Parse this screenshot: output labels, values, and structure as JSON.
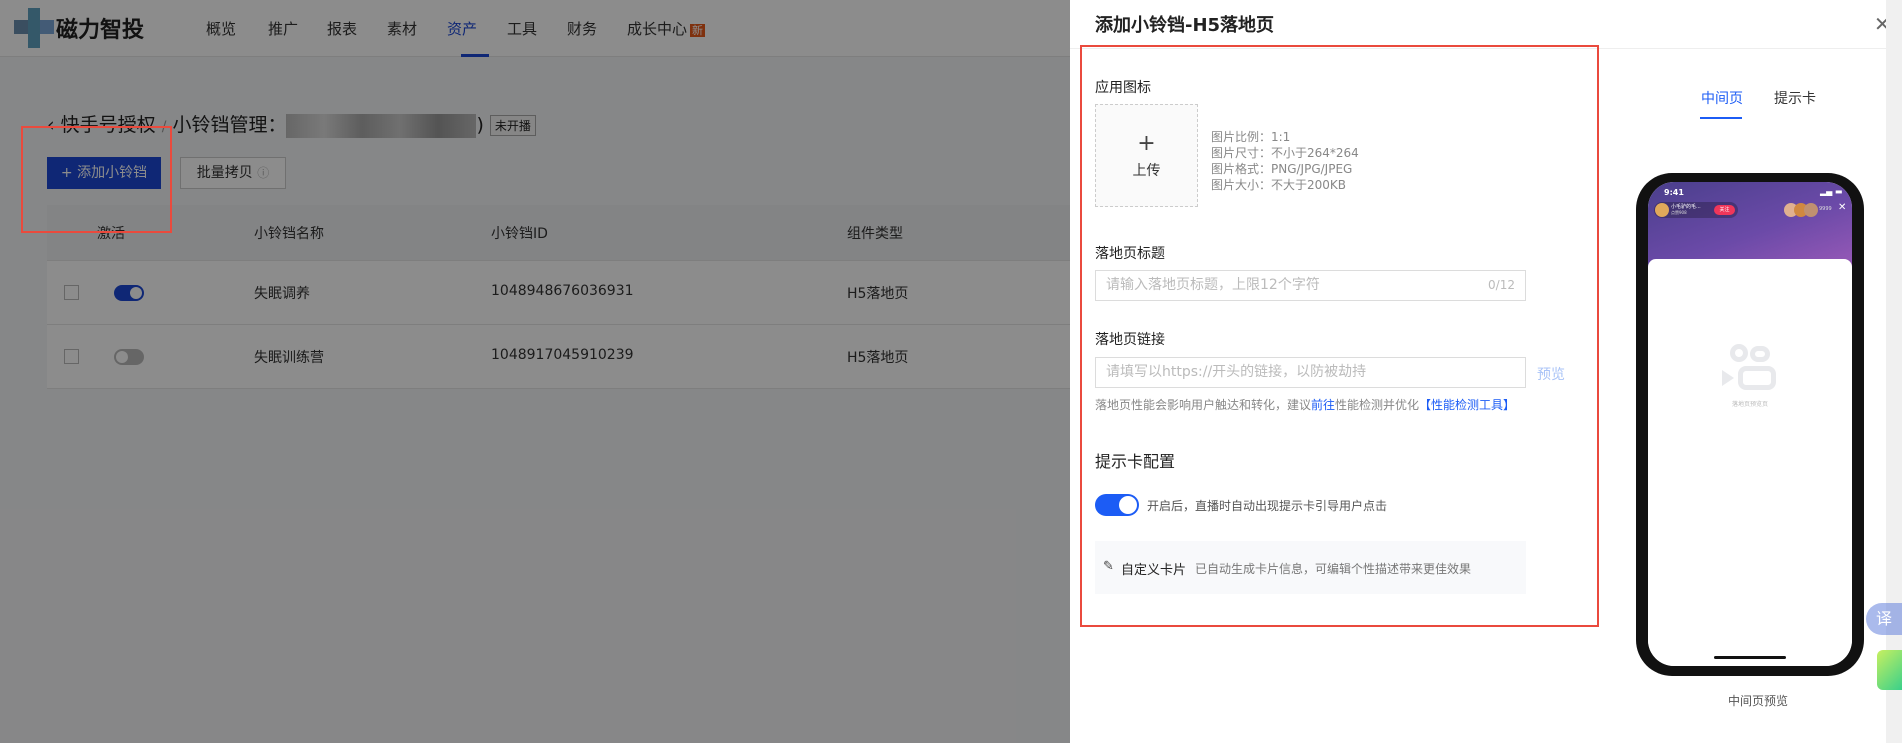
{
  "nav": {
    "brand": "磁力智投",
    "items": [
      "概览",
      "推广",
      "报表",
      "素材",
      "资产",
      "工具",
      "财务",
      "成长中心"
    ],
    "active": "资产",
    "new_badge": "新"
  },
  "breadcrumb": {
    "parent": "快手号授权",
    "sep": "/",
    "current": "小铃铛管理：",
    "suffix": ")",
    "status": "未开播"
  },
  "actions": {
    "add": "+ 添加小铃铛",
    "batch": "批量拷贝"
  },
  "table": {
    "headers": [
      "激活",
      "小铃铛名称",
      "小铃铛ID",
      "组件类型"
    ],
    "rows": [
      {
        "active": true,
        "name": "失眠调养",
        "id": "1048948676036931",
        "type": "H5落地页"
      },
      {
        "active": false,
        "name": "失眠训练营",
        "id": "1048917045910239",
        "type": "H5落地页"
      }
    ]
  },
  "drawer": {
    "title": "添加小铃铛-H5落地页",
    "icon_label": "应用图标",
    "upload_label": "上传",
    "icon_info": [
      "图片比例：1:1",
      "图片尺寸：不小于264*264",
      "图片格式：PNG/JPG/JPEG",
      "图片大小：不大于200KB"
    ],
    "title_label": "落地页标题",
    "title_placeholder": "请输入落地页标题，上限12个字符",
    "title_count": "0/12",
    "link_label": "落地页链接",
    "link_placeholder": "请填写以https://开头的链接，以防被劫持",
    "preview": "预览",
    "hint_pre": "落地页性能会影响用户触达和转化，建议",
    "hint_link": "前往",
    "hint_mid": "性能检测并优化",
    "hint_tool": "【性能检测工具】",
    "card_section": "提示卡配置",
    "toggle_on": true,
    "toggle_text": "开启后，直播时自动出现提示卡引导用户点击",
    "custom_card": "自定义卡片",
    "custom_card_desc": "已自动生成卡片信息，可编辑个性描述带来更佳效果"
  },
  "preview_panel": {
    "tabs": [
      "中间页",
      "提示卡"
    ],
    "active_tab": "中间页",
    "time": "9:41",
    "streamer": "小毛驴的毛...",
    "likes": "点赞908",
    "follow": "关注",
    "viewers": "9999",
    "placeholder": "落地页预览页",
    "caption": "中间页预览"
  },
  "translate": "译",
  "colors": {
    "primary": "#1c48d6",
    "accent": "#1c5cf5",
    "highlight": "#ea4a3d"
  }
}
